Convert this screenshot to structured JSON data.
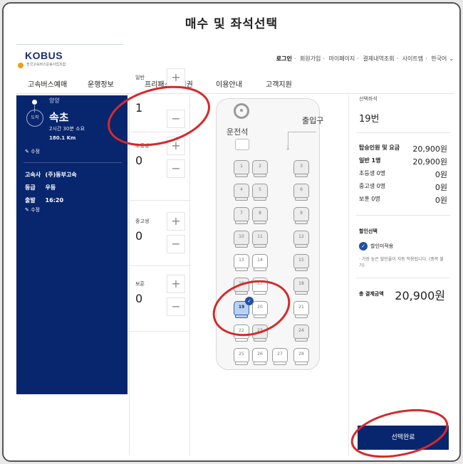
{
  "window": {
    "title": "매수 및 좌석선택"
  },
  "logo": {
    "text": "KOBUS",
    "sub": "전국고속버스운송사업조합"
  },
  "utility_links": [
    "로그인",
    "회원가입",
    "마이페이지",
    "결제내역조회",
    "사이트맵",
    "한국어"
  ],
  "gnb": [
    "고속버스예매",
    "운행정보",
    "프리패스/정기권",
    "이용안내",
    "고객지원"
  ],
  "route": {
    "departure_city": "양양",
    "arrive_badge": "도착",
    "arrival_city": "속초",
    "duration": "2시간 30분 소요",
    "distance": "180.1 Km",
    "edit_label": "수정",
    "carrier_key": "고속사",
    "carrier": "(주)동부고속",
    "grade_key": "등급",
    "grade": "우등",
    "depart_key": "출발",
    "depart_time": "16:20",
    "edit_label2": "수정"
  },
  "counters": [
    {
      "label": "일반",
      "value": "1"
    },
    {
      "label": "초등생",
      "value": "0"
    },
    {
      "label": "중고생",
      "value": "0"
    },
    {
      "label": "보훈",
      "value": "0"
    }
  ],
  "seatmap": {
    "driver_label": "운전석",
    "door_label": "출입구",
    "seats": [
      {
        "no": "1",
        "state": "sold"
      },
      {
        "no": "2",
        "state": "sold"
      },
      {
        "no": "3",
        "state": "sold"
      },
      {
        "no": "4",
        "state": "sold"
      },
      {
        "no": "5",
        "state": "sold"
      },
      {
        "no": "6",
        "state": "sold"
      },
      {
        "no": "7",
        "state": "sold"
      },
      {
        "no": "8",
        "state": "sold"
      },
      {
        "no": "9",
        "state": "sold"
      },
      {
        "no": "10",
        "state": "sold"
      },
      {
        "no": "11",
        "state": "sold"
      },
      {
        "no": "12",
        "state": "sold"
      },
      {
        "no": "13",
        "state": "available"
      },
      {
        "no": "14",
        "state": "available"
      },
      {
        "no": "15",
        "state": "sold"
      },
      {
        "no": "16",
        "state": "sold"
      },
      {
        "no": "17",
        "state": "available"
      },
      {
        "no": "18",
        "state": "sold"
      },
      {
        "no": "19",
        "state": "selected"
      },
      {
        "no": "20",
        "state": "available"
      },
      {
        "no": "21",
        "state": "available"
      },
      {
        "no": "22",
        "state": "available"
      },
      {
        "no": "23",
        "state": "sold"
      },
      {
        "no": "24",
        "state": "sold"
      },
      {
        "no": "25",
        "state": "available"
      },
      {
        "no": "26",
        "state": "available"
      },
      {
        "no": "27",
        "state": "available"
      },
      {
        "no": "28",
        "state": "available"
      }
    ]
  },
  "summary": {
    "selected_title": "선택좌석",
    "selected_seat": "19번",
    "fare_header": "탑승인원 및 요금",
    "fare_total": "20,900원",
    "rows": [
      {
        "k": "일반 1명",
        "v": "20,900원"
      },
      {
        "k": "초등생 0명",
        "v": "0원"
      },
      {
        "k": "중고생 0명",
        "v": "0원"
      },
      {
        "k": "보훈 0명",
        "v": "0원"
      }
    ],
    "discount_title": "할인선택",
    "discount_option": "할인미적용",
    "discount_note": "· 가장 높은 할인율이 자동 적용됩니다. (중복 불가)",
    "total_label": "총 결제금액",
    "total_value": "20,900원",
    "confirm_button": "선택완료"
  },
  "colors": {
    "navy": "#08266e",
    "accent": "#1f4fa3",
    "annotation": "#d42a2a"
  }
}
